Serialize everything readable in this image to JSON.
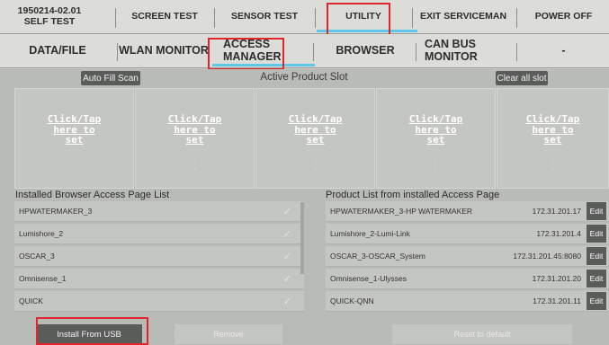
{
  "tabs_row1": [
    {
      "label": "1950214-02.01\nSELF TEST"
    },
    {
      "label": "SCREEN TEST"
    },
    {
      "label": "SENSOR TEST"
    },
    {
      "label": "UTILITY"
    },
    {
      "label": "EXIT SERVICEMAN"
    },
    {
      "label": "POWER OFF"
    }
  ],
  "tabs_row2": [
    {
      "label": "DATA/FILE"
    },
    {
      "label": "WLAN MONITOR"
    },
    {
      "label": "ACCESS\nMANAGER"
    },
    {
      "label": "BROWSER"
    },
    {
      "label": "CAN BUS\nMONITOR"
    },
    {
      "label": "-"
    }
  ],
  "slots": {
    "auto_fill_label": "Auto Fill Scan",
    "title": "Active Product Slot",
    "clear_all_label": "Clear all slot",
    "items": [
      {
        "text": "Click/Tap\nhere to\nset"
      },
      {
        "text": "Click/Tap\nhere to\nset"
      },
      {
        "text": "Click/Tap\nhere to\nset"
      },
      {
        "text": "Click/Tap\nhere to\nset"
      },
      {
        "text": "Click/Tap\nhere to\nset"
      }
    ]
  },
  "installed_list": {
    "title": "Installed Browser Access Page List",
    "items": [
      "HPWATERMAKER_3",
      "Lumishore_2",
      "OSCAR_3",
      "Omnisense_1",
      "QUICK"
    ],
    "install_usb_label": "Install From USB",
    "remove_label": "Remove"
  },
  "product_list": {
    "title": "Product List from installed Access Page",
    "items": [
      {
        "name": "HPWATERMAKER_3-HP WATERMAKER",
        "ip": "172.31.201.17",
        "edit": "Edit"
      },
      {
        "name": "Lumishore_2-Lumi-Link",
        "ip": "172.31.201.4",
        "edit": "Edit"
      },
      {
        "name": "OSCAR_3-OSCAR_System",
        "ip": "172.31.201.45:8080",
        "edit": "Edit"
      },
      {
        "name": "Omnisense_1-Ulysses",
        "ip": "172.31.201.20",
        "edit": "Edit"
      },
      {
        "name": "QUICK-QNN",
        "ip": "172.31.201.11",
        "edit": "Edit"
      }
    ],
    "reset_label": "Reset to default"
  },
  "colors": {
    "accent_underline": "#5fc8e8",
    "highlight_box": "#e0262a"
  }
}
